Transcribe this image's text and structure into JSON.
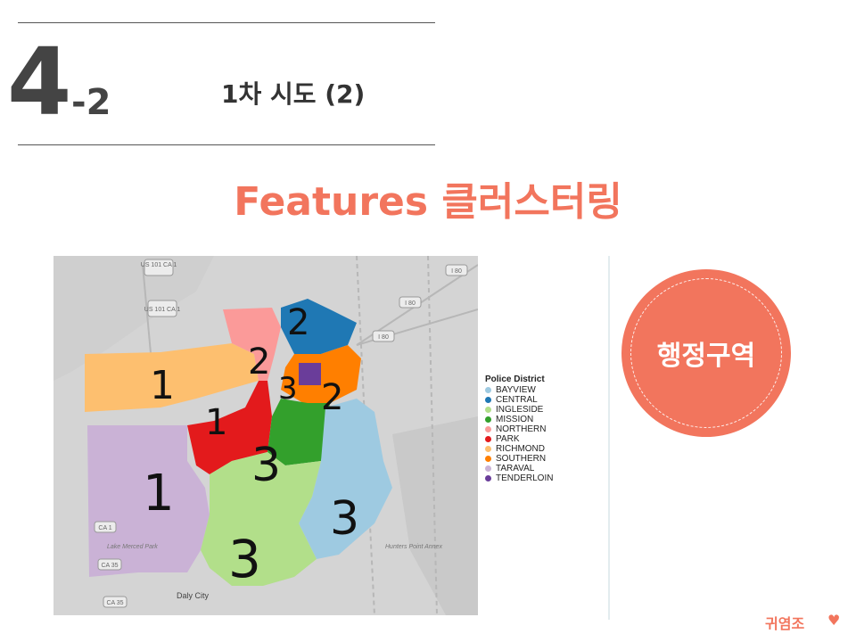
{
  "header": {
    "section_number": "4",
    "section_sub": "-2",
    "heading": "1차 시도 (2)"
  },
  "title": "Features 클러스터링",
  "map": {
    "highway_labels": [
      "US 101 CA 1",
      "US 101 CA 1",
      "I 80",
      "I 80",
      "I 80",
      "CA 1",
      "CA 35",
      "CA 35"
    ],
    "place_labels": [
      "Lake Merced Park",
      "Hunters Point Annex",
      "Daly City"
    ],
    "handwritten_cluster_marks": [
      "1",
      "1",
      "1",
      "2",
      "2",
      "2",
      "3",
      "3",
      "3",
      "3"
    ]
  },
  "legend": {
    "title": "Police District",
    "items": [
      {
        "label": "BAYVIEW",
        "color": "#9ecae1"
      },
      {
        "label": "CENTRAL",
        "color": "#1f78b4"
      },
      {
        "label": "INGLESIDE",
        "color": "#b2df8a"
      },
      {
        "label": "MISSION",
        "color": "#33a02c"
      },
      {
        "label": "NORTHERN",
        "color": "#fb9a99"
      },
      {
        "label": "PARK",
        "color": "#e31a1c"
      },
      {
        "label": "RICHMOND",
        "color": "#fdbf6f"
      },
      {
        "label": "SOUTHERN",
        "color": "#ff7f00"
      },
      {
        "label": "TARAVAL",
        "color": "#cab2d6"
      },
      {
        "label": "TENDERLOIN",
        "color": "#6a3d9a"
      }
    ]
  },
  "badge": {
    "label": "행정구역"
  },
  "footer": {
    "team": "귀염조",
    "icon": "heart-icon"
  },
  "colors": {
    "accent": "#F2755D",
    "text": "#444444"
  }
}
